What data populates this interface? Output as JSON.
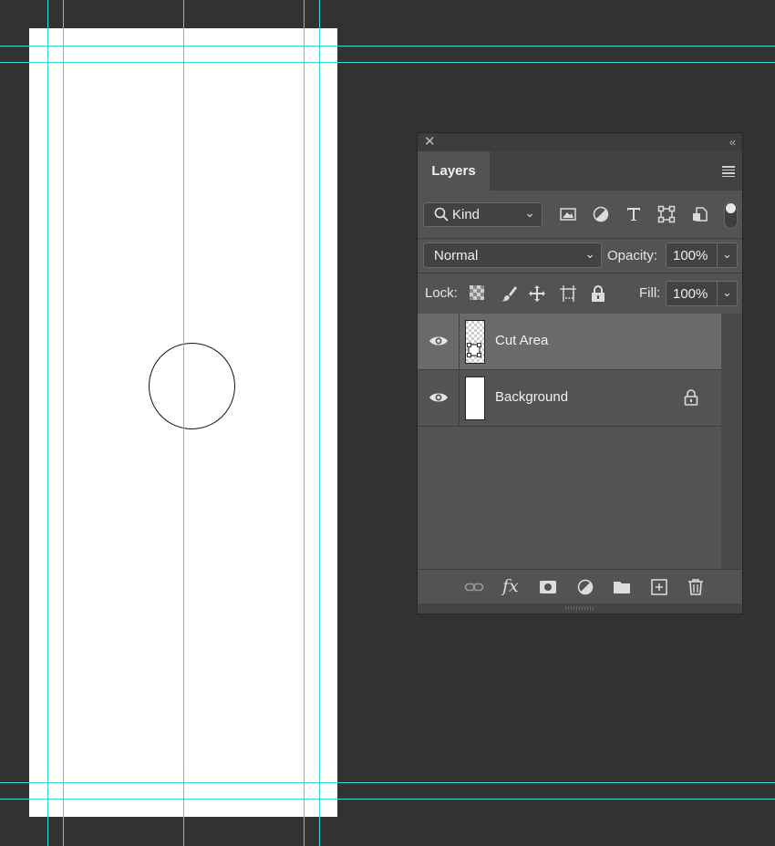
{
  "canvas": {
    "background": "#ffffff",
    "guide_color": "#38d6d6"
  },
  "layers_panel": {
    "tab_label": "Layers",
    "filter": {
      "kind_label": "Kind",
      "icons": [
        "image-filter-icon",
        "adjustment-filter-icon",
        "type-filter-icon",
        "shape-filter-icon",
        "smart-object-filter-icon"
      ]
    },
    "blend_mode": "Normal",
    "opacity_label": "Opacity:",
    "opacity_value": "100%",
    "lock_label": "Lock:",
    "fill_label": "Fill:",
    "fill_value": "100%",
    "layers": [
      {
        "name": "Cut Area",
        "visible": true,
        "selected": true,
        "locked": false
      },
      {
        "name": "Background",
        "visible": true,
        "selected": false,
        "locked": true
      }
    ],
    "bottom_icons": [
      "link-layers-icon",
      "fx-icon",
      "add-mask-icon",
      "adjustment-layer-icon",
      "new-group-icon",
      "new-layer-icon",
      "delete-icon"
    ]
  }
}
